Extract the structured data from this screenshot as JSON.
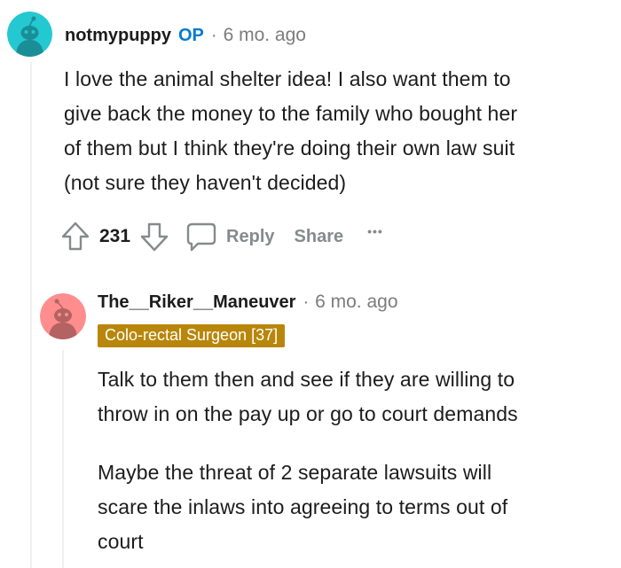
{
  "comment": {
    "username": "notmypuppy",
    "op_badge": "OP",
    "separator": "·",
    "timestamp": "6 mo. ago",
    "avatar_color": "#24c8d0",
    "lines": [
      "I love the animal shelter idea! I also want them to",
      "give back the money to the family who bought her",
      "of them but I think they're doing their own law suit",
      "(not sure they haven't decided)"
    ],
    "actions": {
      "upvote_icon": "arrow-up-icon",
      "vote_count": "231",
      "downvote_icon": "arrow-down-icon",
      "reply_icon": "chat-bubble-icon",
      "reply_label": "Reply",
      "share_label": "Share",
      "more_label": "•••"
    }
  },
  "reply": {
    "username": "The__Riker__Maneuver",
    "separator": "·",
    "timestamp": "6 mo. ago",
    "avatar_color": "#ff8d8d",
    "flair": "Colo-rectal Surgeon [37]",
    "flair_color": "#b8860b",
    "paragraphs": [
      {
        "lines": [
          "Talk to them then and see if they are willing to",
          "throw in on the pay up or go to court demands"
        ]
      },
      {
        "lines": [
          "Maybe the threat of 2 separate lawsuits will",
          "scare the inlaws into agreeing to terms out of",
          "court"
        ]
      }
    ]
  }
}
